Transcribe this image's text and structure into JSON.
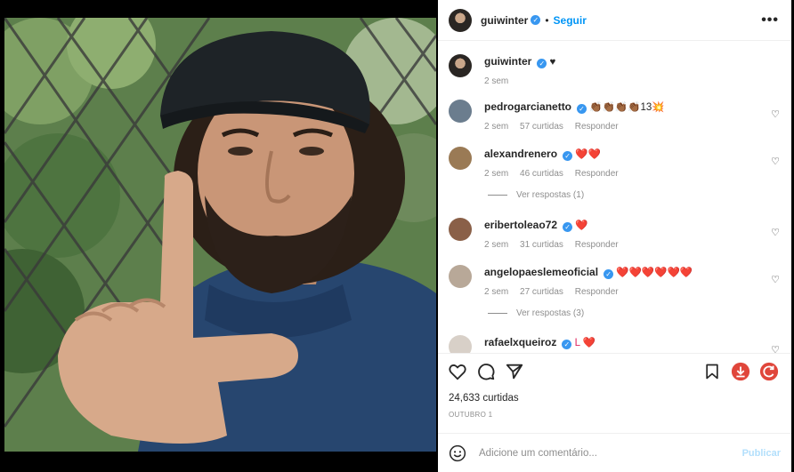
{
  "header": {
    "username": "guiwinter",
    "separator": "•",
    "follow_label": "Seguir",
    "more_label": "•••"
  },
  "caption": {
    "username": "guiwinter",
    "text": "♥",
    "time": "2 sem"
  },
  "comments": [
    {
      "username": "pedrogarcianetto",
      "text": "👏🏾👏🏾👏🏾👏🏾13💥",
      "time": "2 sem",
      "likes": "57 curtidas",
      "reply": "Responder",
      "view_replies": ""
    },
    {
      "username": "alexandrenero",
      "text": "❤️❤️",
      "time": "2 sem",
      "likes": "46 curtidas",
      "reply": "Responder",
      "view_replies": "Ver respostas (1)"
    },
    {
      "username": "eribertoleao72",
      "text": "❤️",
      "time": "2 sem",
      "likes": "31 curtidas",
      "reply": "Responder",
      "view_replies": ""
    },
    {
      "username": "angelopaeslemeoficial",
      "text": "❤️❤️❤️❤️❤️❤️",
      "time": "2 sem",
      "likes": "27 curtidas",
      "reply": "Responder",
      "view_replies": "Ver respostas (3)"
    },
    {
      "username": "rafaelxqueiroz",
      "text": "L ❤️",
      "time": "",
      "likes": "",
      "reply": "",
      "view_replies": ""
    }
  ],
  "actions": {
    "likes_count": "24,633 curtidas",
    "date": "OUTUBRO 1"
  },
  "add_comment": {
    "placeholder": "Adicione um comentário...",
    "publish_label": "Publicar"
  },
  "colors": {
    "accent": "#0095f6",
    "verified": "#3897f0",
    "muted": "#8e8e8e",
    "download": "#e0463b",
    "refresh": "#e0463b"
  },
  "icons": [
    "heart-icon",
    "comment-icon",
    "share-icon",
    "bookmark-icon",
    "download-icon",
    "refresh-icon",
    "emoji-icon",
    "more-icon"
  ]
}
